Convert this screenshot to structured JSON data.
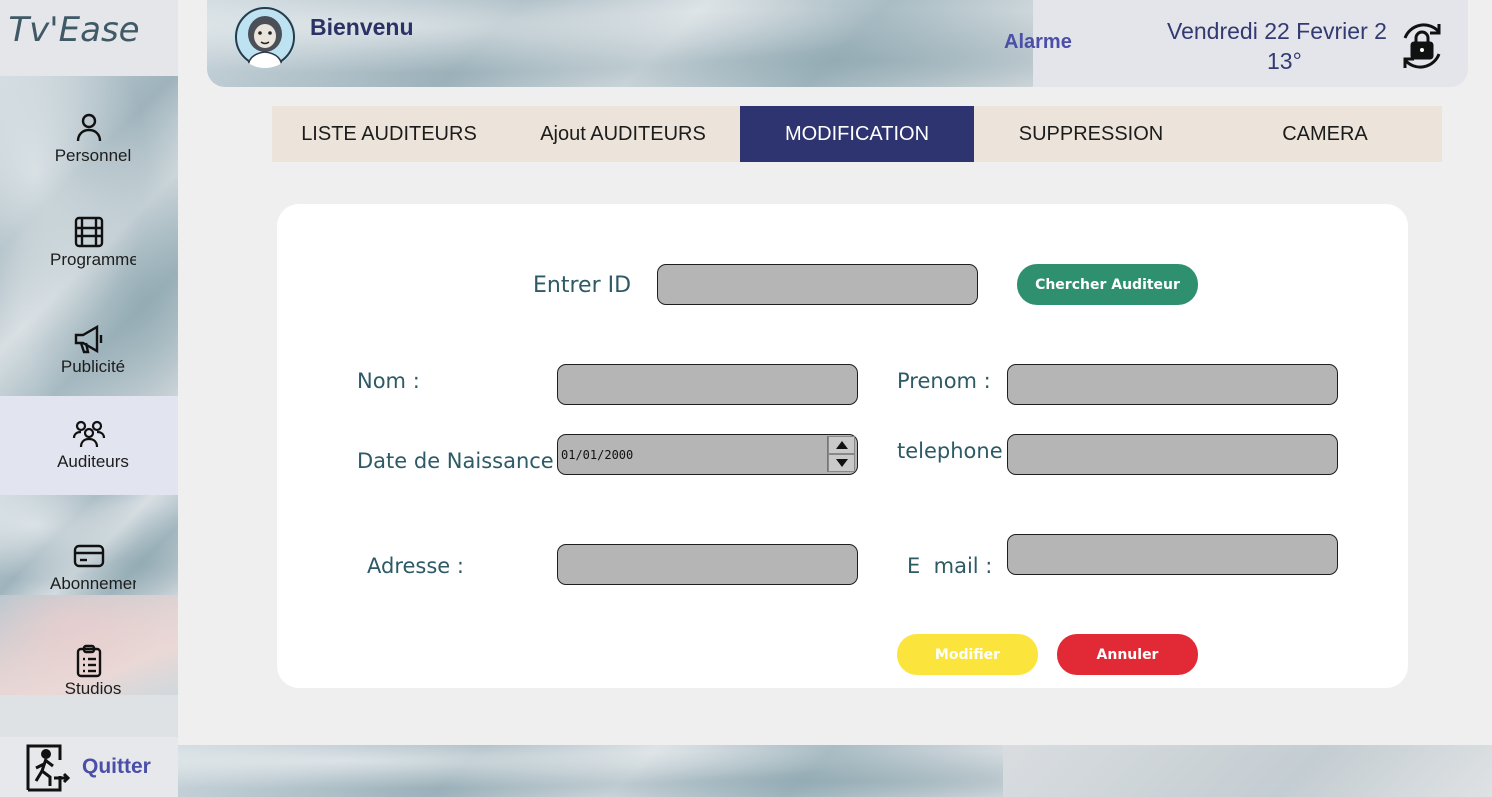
{
  "app": {
    "logo": "Tv'Ease"
  },
  "sidebar": {
    "items": [
      {
        "label": "Personnel",
        "icon": "user-icon"
      },
      {
        "label": "Programmes",
        "icon": "film-icon"
      },
      {
        "label": "Publicité",
        "icon": "megaphone-icon"
      },
      {
        "label": "Auditeurs",
        "icon": "users-icon",
        "active": true
      },
      {
        "label": "Abonnements",
        "icon": "card-icon"
      },
      {
        "label": "Studios",
        "icon": "clipboard-icon"
      }
    ],
    "quit_label": "Quitter"
  },
  "header": {
    "welcome": "Bienvenu",
    "alarm": "Alarme",
    "date": "Vendredi 22  Fevrier 2",
    "temperature": "13°"
  },
  "tabs": [
    {
      "label": "LISTE AUDITEURS"
    },
    {
      "label": "Ajout AUDITEURS"
    },
    {
      "label": "MODIFICATION",
      "active": true
    },
    {
      "label": "SUPPRESSION"
    },
    {
      "label": "CAMERA"
    }
  ],
  "form": {
    "id_label": "Entrer ID",
    "search_button": "Chercher Auditeur",
    "nom_label": "Nom :",
    "prenom_label": "Prenom :",
    "birth_label": "Date de Naissance :",
    "birth_value": "01/01/2000",
    "phone_label": "telephone",
    "address_label": "Adresse :",
    "email_label": "E  mail :",
    "modify_button": "Modifier",
    "cancel_button": "Annuler"
  },
  "colors": {
    "accent": "#2e3470",
    "search_button": "#2f9070",
    "modify_button": "#fbe53c",
    "cancel_button": "#e12a35",
    "field_bg": "#b5b5b5"
  }
}
